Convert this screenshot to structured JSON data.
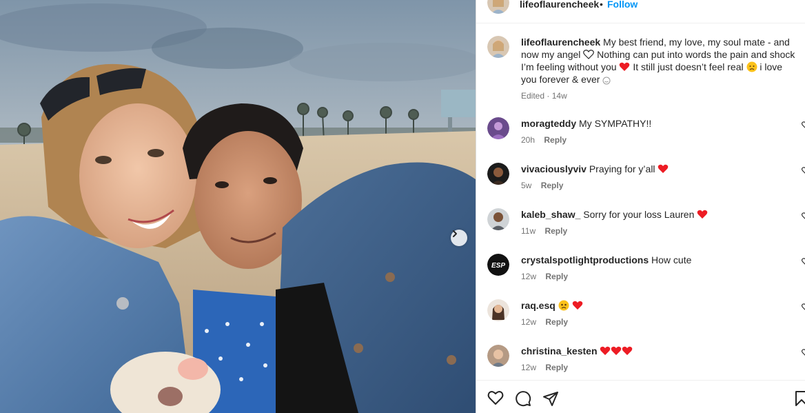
{
  "post": {
    "author": "lifeoflaurencheek",
    "separator": "•",
    "follow_label": "Follow"
  },
  "caption": {
    "username": "lifeoflaurencheek",
    "text_part1": "My best friend, my love, my soul mate - and now my angel",
    "text_part2": "Nothing can put into words the pain and shock I’m feeling without you",
    "text_part3": "It still just doesn’t feel real",
    "text_part4": "i love you forever & ever",
    "edited": "Edited",
    "time": "14w"
  },
  "comments": [
    {
      "username": "moragteddy",
      "text": "My SYMPATHY!!",
      "time": "20h",
      "reply": "Reply"
    },
    {
      "username": "vivaciouslyviv",
      "text": "Praying for y’all",
      "time": "5w",
      "reply": "Reply"
    },
    {
      "username": "kaleb_shaw_",
      "text": "Sorry for your loss Lauren",
      "time": "11w",
      "reply": "Reply"
    },
    {
      "username": "crystalspotlightproductions",
      "text": "How cute",
      "time": "12w",
      "reply": "Reply"
    },
    {
      "username": "raq.esq",
      "text": "",
      "time": "12w",
      "reply": "Reply"
    },
    {
      "username": "christina_kesten",
      "text": "",
      "time": "12w",
      "reply": "Reply"
    }
  ],
  "icons": {
    "like": "heart-outline-icon",
    "comment": "speech-bubble-icon",
    "share": "paper-plane-icon",
    "save": "bookmark-icon",
    "next": "chevron-right-icon"
  },
  "colors": {
    "link": "#0095f6",
    "heart_red": "#ed1c24",
    "muted": "#737373"
  }
}
